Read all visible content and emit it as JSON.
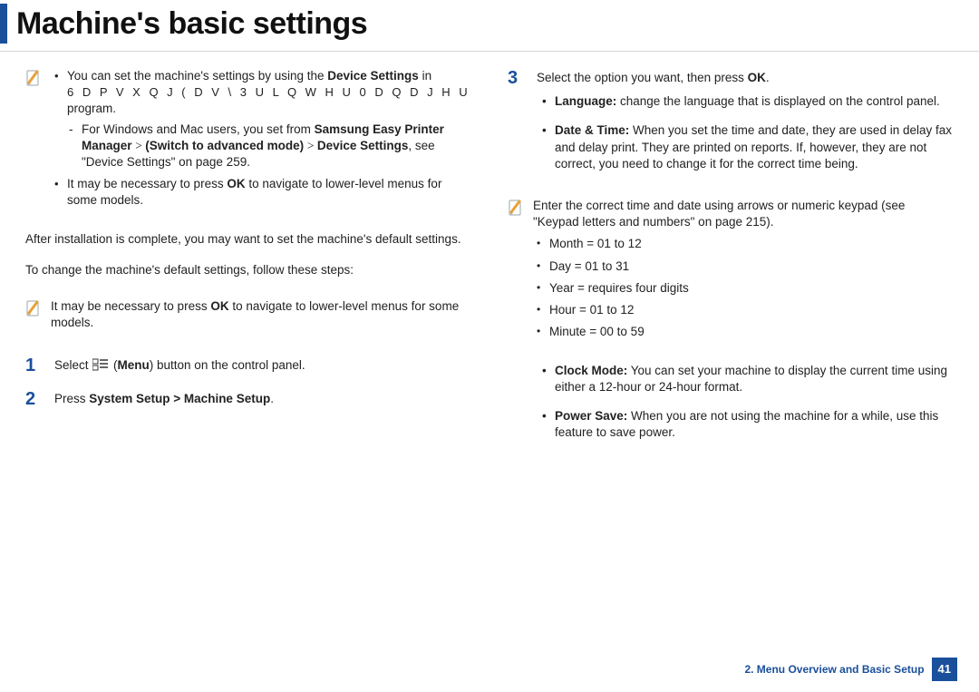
{
  "title": "Machine's basic settings",
  "col1": {
    "note1": {
      "b1_pre": "You can set the machine's settings by using the ",
      "b1_bold": "Device Settings",
      "b1_post": " in",
      "garbled": "6 D P V X Q J  ( D V \\  3 U L Q W H U  0 D Q D J H U",
      "garbled_mid": " program.",
      "dash_pre": "For Windows and Mac users, you set from ",
      "dash_bold1": "Samsung Easy Printer",
      "dash_line2_bold1": "Manager",
      "dash_line2_sep": "  >  ",
      "dash_line2_bold2": "(Switch to advanced mode)",
      "dash_line2_sep2": "  > ",
      "dash_line2_bold3": "Device Settings",
      "dash_line2_post": ", see \"Device Settings\" on page 259.",
      "b2_pre": "It may be necessary to press ",
      "b2_bold": "OK",
      "b2_post": " to navigate to lower-level menus for some models."
    },
    "p1": "After installation is complete, you may want to set the machine's default settings.",
    "p2": "To change the machine's default settings, follow these steps:",
    "note2": {
      "pre": "It may be necessary to press ",
      "bold": "OK",
      "post": " to navigate to lower-level menus for some models."
    },
    "step1": {
      "num": "1",
      "pre": "Select ",
      "menu_paren_open": " (",
      "menu_bold": "Menu",
      "menu_paren_close": ") button on the control panel."
    },
    "step2": {
      "num": "2",
      "pre": "Press ",
      "bold": "System Setup > Machine Setup",
      "post": "."
    }
  },
  "col2": {
    "step3": {
      "num": "3",
      "pre": "Select the option you want, then press ",
      "bold": "OK",
      "post": ".",
      "lang_bold": "Language:",
      "lang_text": " change the language that is displayed on the control panel.",
      "dt_bold": "Date & Time:",
      "dt_text": " When you set the time and date, they are used in delay fax and delay print. They are printed on reports. If, however, they are not correct, you need to change it for the correct time being."
    },
    "note3": {
      "text": "Enter the correct time and date using arrows or numeric keypad (see \"Keypad letters and numbers\" on page 215).",
      "mb1": "Month = 01 to 12",
      "mb2": "Day = 01 to 31",
      "mb3": "Year = requires four digits",
      "mb4": "Hour = 01 to 12",
      "mb5": "Minute = 00 to 59"
    },
    "clock_bold": "Clock Mode:",
    "clock_text": " You can set your machine to display the current time using either a 12-hour or 24-hour format.",
    "power_bold": "Power Save:",
    "power_text": " When you are not using the machine for a while, use this feature to save power."
  },
  "footer": {
    "chapter": "2. Menu Overview and Basic Setup",
    "page": "41"
  }
}
